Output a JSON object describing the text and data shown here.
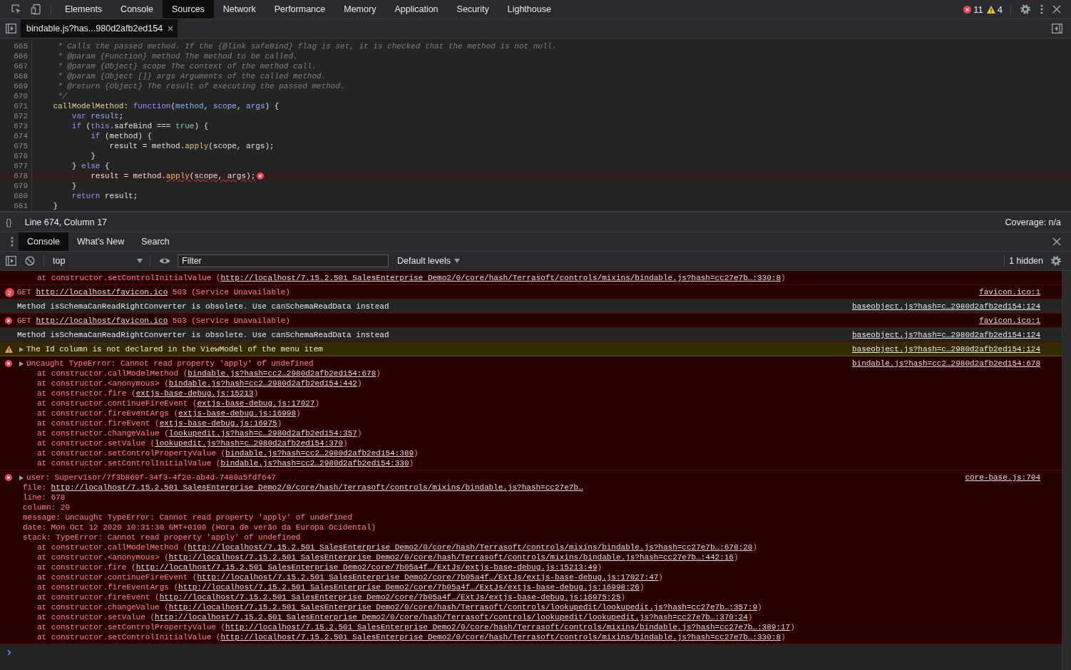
{
  "toolbar": {
    "tabs": [
      {
        "label": "Elements",
        "selected": false
      },
      {
        "label": "Console",
        "selected": false
      },
      {
        "label": "Sources",
        "selected": true
      },
      {
        "label": "Network",
        "selected": false
      },
      {
        "label": "Performance",
        "selected": false
      },
      {
        "label": "Memory",
        "selected": false
      },
      {
        "label": "Application",
        "selected": false
      },
      {
        "label": "Security",
        "selected": false
      },
      {
        "label": "Lighthouse",
        "selected": false
      }
    ],
    "error_count": "11",
    "warning_count": "4"
  },
  "editor": {
    "file_tab": "bindable.js?has...980d2afb2ed154",
    "lines": [
      {
        "number": "665",
        "error": false,
        "tokens": [
          {
            "kind": "comment",
            "text": "     * Calls the passed method. If the {@link safeBind} flag is set, it is checked that the method is not null."
          }
        ]
      },
      {
        "number": "666",
        "error": false,
        "tokens": [
          {
            "kind": "comment",
            "text": "     * @param {Function} method The method to be called."
          }
        ]
      },
      {
        "number": "667",
        "error": false,
        "tokens": [
          {
            "kind": "comment",
            "text": "     * @param {Object} scope The context of the method call."
          }
        ]
      },
      {
        "number": "668",
        "error": false,
        "tokens": [
          {
            "kind": "comment",
            "text": "     * @param {Object []} args Arguments of the called method."
          }
        ]
      },
      {
        "number": "669",
        "error": false,
        "tokens": [
          {
            "kind": "comment",
            "text": "     * @return {Object} The result of executing the passed method."
          }
        ]
      },
      {
        "number": "670",
        "error": false,
        "tokens": [
          {
            "kind": "comment",
            "text": "     */"
          }
        ]
      },
      {
        "number": "671",
        "error": false,
        "tokens": [
          {
            "kind": "def",
            "text": "    callModelMethod"
          },
          {
            "kind": "plain",
            "text": ": "
          },
          {
            "kind": "keyword",
            "text": "function"
          },
          {
            "kind": "plain",
            "text": "("
          },
          {
            "kind": "param",
            "text": "method"
          },
          {
            "kind": "plain",
            "text": ", "
          },
          {
            "kind": "param",
            "text": "scope"
          },
          {
            "kind": "plain",
            "text": ", "
          },
          {
            "kind": "param",
            "text": "args"
          },
          {
            "kind": "plain",
            "text": ") {"
          }
        ]
      },
      {
        "number": "672",
        "error": false,
        "tokens": [
          {
            "kind": "keyword",
            "text": "        var"
          },
          {
            "kind": "param",
            "text": " result"
          },
          {
            "kind": "plain",
            "text": ";"
          }
        ]
      },
      {
        "number": "673",
        "error": false,
        "tokens": [
          {
            "kind": "keyword",
            "text": "        if"
          },
          {
            "kind": "plain",
            "text": " ("
          },
          {
            "kind": "keyword",
            "text": "this"
          },
          {
            "kind": "plain",
            "text": ".safeBind === "
          },
          {
            "kind": "atom",
            "text": "true"
          },
          {
            "kind": "plain",
            "text": ") {"
          }
        ]
      },
      {
        "number": "674",
        "error": false,
        "tokens": [
          {
            "kind": "keyword",
            "text": "            if"
          },
          {
            "kind": "plain",
            "text": " (method) {"
          }
        ]
      },
      {
        "number": "675",
        "error": false,
        "tokens": [
          {
            "kind": "plain",
            "text": "                result = method."
          },
          {
            "kind": "call",
            "text": "apply"
          },
          {
            "kind": "plain",
            "text": "(scope, args);"
          }
        ]
      },
      {
        "number": "676",
        "error": false,
        "tokens": [
          {
            "kind": "plain",
            "text": "            }"
          }
        ]
      },
      {
        "number": "677",
        "error": false,
        "tokens": [
          {
            "kind": "plain",
            "text": "        } "
          },
          {
            "kind": "keyword",
            "text": "else"
          },
          {
            "kind": "plain",
            "text": " {"
          }
        ]
      },
      {
        "number": "678",
        "error": true,
        "tokens": [
          {
            "kind": "plain",
            "text": "            result = method."
          },
          {
            "kind": "call-error",
            "text": "apply"
          },
          {
            "kind": "plain-error",
            "text": "(scope, args);"
          }
        ]
      },
      {
        "number": "679",
        "error": false,
        "tokens": [
          {
            "kind": "plain",
            "text": "        }"
          }
        ]
      },
      {
        "number": "680",
        "error": false,
        "tokens": [
          {
            "kind": "keyword",
            "text": "        return"
          },
          {
            "kind": "plain",
            "text": " result;"
          }
        ]
      },
      {
        "number": "681",
        "error": false,
        "tokens": [
          {
            "kind": "plain",
            "text": "    }"
          }
        ]
      }
    ]
  },
  "status_bar": {
    "pretty_print": "{}",
    "position": "Line 674, Column 17",
    "coverage": "Coverage: n/a"
  },
  "drawer": {
    "tabs": [
      {
        "label": "Console",
        "selected": true
      },
      {
        "label": "What's New",
        "selected": false
      },
      {
        "label": "Search",
        "selected": false
      }
    ]
  },
  "console_toolbar": {
    "context": "top",
    "filter_placeholder": "Filter",
    "levels": "Default levels",
    "hidden": "1 hidden"
  },
  "messages": [
    {
      "kind": "continuation",
      "expandable": false,
      "lines": [
        {
          "kind": "frame",
          "parts": [
            "at constructor.setControlInitialValue (",
            {
              "link": "http://localhost/7.15.2.501 SalesEnterprise Demo2/0/core/hash/Terrasoft/controls/mixins/bindable.js?hash=cc27e7b…:330:8"
            },
            ")"
          ]
        }
      ]
    },
    {
      "kind": "error",
      "count": "2",
      "expandable": false,
      "source": "favicon.ico:1",
      "lines": [
        {
          "kind": "plain",
          "parts": [
            "GET ",
            {
              "link": "http://localhost/favicon.ico"
            },
            " 503 (Service Unavailable)"
          ]
        }
      ]
    },
    {
      "kind": "info",
      "expandable": false,
      "source": "baseobject.js?hash=c…2980d2afb2ed154:124",
      "lines": [
        {
          "kind": "plain",
          "parts": [
            "Method isSchemaCanReadRightConverter is obsolete. Use canSchemaReadData instead"
          ]
        }
      ]
    },
    {
      "kind": "error",
      "expandable": false,
      "source": "favicon.ico:1",
      "lines": [
        {
          "kind": "plain",
          "parts": [
            "GET ",
            {
              "link": "http://localhost/favicon.ico"
            },
            " 503 (Service Unavailable)"
          ]
        }
      ]
    },
    {
      "kind": "info",
      "expandable": false,
      "source": "baseobject.js?hash=c…2980d2afb2ed154:124",
      "lines": [
        {
          "kind": "plain",
          "parts": [
            "Method isSchemaCanReadRightConverter is obsolete. Use canSchemaReadData instead"
          ]
        }
      ]
    },
    {
      "kind": "warning",
      "expandable": true,
      "source": "baseobject.js?hash=c…2980d2afb2ed154:124",
      "lines": [
        {
          "kind": "plain",
          "parts": [
            "The Id column is not declared in the ViewModel of the menu item"
          ]
        }
      ]
    },
    {
      "kind": "error",
      "expandable": true,
      "source": "bindable.js?hash=cc2…2980d2afb2ed154:678",
      "lines": [
        {
          "kind": "plain",
          "parts": [
            "Uncaught TypeError: Cannot read property 'apply' of undefined"
          ]
        },
        {
          "kind": "frame",
          "parts": [
            "at constructor.callModelMethod (",
            {
              "link": "bindable.js?hash=cc2…2980d2afb2ed154:678"
            },
            ")"
          ]
        },
        {
          "kind": "frame",
          "parts": [
            "at constructor.<anonymous> (",
            {
              "link": "bindable.js?hash=cc2…2980d2afb2ed154:442"
            },
            ")"
          ]
        },
        {
          "kind": "frame",
          "parts": [
            "at constructor.fire (",
            {
              "link": "extjs-base-debug.js:15213"
            },
            ")"
          ]
        },
        {
          "kind": "frame",
          "parts": [
            "at constructor.continueFireEvent (",
            {
              "link": "extjs-base-debug.js:17027"
            },
            ")"
          ]
        },
        {
          "kind": "frame",
          "parts": [
            "at constructor.fireEventArgs (",
            {
              "link": "extjs-base-debug.js:16998"
            },
            ")"
          ]
        },
        {
          "kind": "frame",
          "parts": [
            "at constructor.fireEvent (",
            {
              "link": "extjs-base-debug.js:16975"
            },
            ")"
          ]
        },
        {
          "kind": "frame",
          "parts": [
            "at constructor.changeValue (",
            {
              "link": "lookupedit.js?hash=c…2980d2afb2ed154:357"
            },
            ")"
          ]
        },
        {
          "kind": "frame",
          "parts": [
            "at constructor.setValue (",
            {
              "link": "lookupedit.js?hash=c…2980d2afb2ed154:370"
            },
            ")"
          ]
        },
        {
          "kind": "frame",
          "parts": [
            "at constructor.setControlPropertyValue (",
            {
              "link": "bindable.js?hash=cc2…2980d2afb2ed154:389"
            },
            ")"
          ]
        },
        {
          "kind": "frame",
          "parts": [
            "at constructor.setControlInitialValue (",
            {
              "link": "bindable.js?hash=cc2…2980d2afb2ed154:330"
            },
            ")"
          ]
        }
      ]
    },
    {
      "kind": "error",
      "expandable": true,
      "source": "core-base.js:704",
      "lines": [
        {
          "kind": "plain",
          "parts": [
            "user: Supervisor/7f3b869f-34f3-4f20-ab4d-7480a5fdf647"
          ]
        },
        {
          "kind": "field",
          "parts": [
            "file: ",
            {
              "link": "http://localhost/7.15.2.501 SalesEnterprise Demo2/0/core/hash/Terrasoft/controls/mixins/bindable.js?hash=cc27e7b…"
            }
          ]
        },
        {
          "kind": "field",
          "parts": [
            "line: 678"
          ]
        },
        {
          "kind": "field",
          "parts": [
            "column: 20"
          ]
        },
        {
          "kind": "field",
          "parts": [
            "message: Uncaught TypeError: Cannot read property 'apply' of undefined"
          ]
        },
        {
          "kind": "field",
          "parts": [
            "date: Mon Oct 12 2020 10:31:30 GMT+0100 (Hora de verão da Europa Ocidental)"
          ]
        },
        {
          "kind": "field",
          "parts": [
            "stack: TypeError: Cannot read property 'apply' of undefined"
          ]
        },
        {
          "kind": "frame",
          "parts": [
            "at constructor.callModelMethod (",
            {
              "link": "http://localhost/7.15.2.501 SalesEnterprise Demo2/0/core/hash/Terrasoft/controls/mixins/bindable.js?hash=cc27e7b…:678:20"
            },
            ")"
          ]
        },
        {
          "kind": "frame",
          "parts": [
            "at constructor.<anonymous> (",
            {
              "link": "http://localhost/7.15.2.501 SalesEnterprise Demo2/0/core/hash/Terrasoft/controls/mixins/bindable.js?hash=cc27e7b…:442:16"
            },
            ")"
          ]
        },
        {
          "kind": "frame",
          "parts": [
            "at constructor.fire (",
            {
              "link": "http://localhost/7.15.2.501 SalesEnterprise Demo2/core/7b05a4f…/ExtJs/extjs-base-debug.js:15213:49"
            },
            ")"
          ]
        },
        {
          "kind": "frame",
          "parts": [
            "at constructor.continueFireEvent (",
            {
              "link": "http://localhost/7.15.2.501 SalesEnterprise Demo2/core/7b05a4f…/ExtJs/extjs-base-debug.js:17027:47"
            },
            ")"
          ]
        },
        {
          "kind": "frame",
          "parts": [
            "at constructor.fireEventArgs (",
            {
              "link": "http://localhost/7.15.2.501 SalesEnterprise Demo2/core/7b05a4f…/ExtJs/extjs-base-debug.js:16998:26"
            },
            ")"
          ]
        },
        {
          "kind": "frame",
          "parts": [
            "at constructor.fireEvent (",
            {
              "link": "http://localhost/7.15.2.501 SalesEnterprise Demo2/core/7b05a4f…/ExtJs/extjs-base-debug.js:16975:25"
            },
            ")"
          ]
        },
        {
          "kind": "frame",
          "parts": [
            "at constructor.changeValue (",
            {
              "link": "http://localhost/7.15.2.501 SalesEnterprise Demo2/0/core/hash/Terrasoft/controls/lookupedit/lookupedit.js?hash=cc27e7b…:357:9"
            },
            ")"
          ]
        },
        {
          "kind": "frame",
          "parts": [
            "at constructor.setValue (",
            {
              "link": "http://localhost/7.15.2.501 SalesEnterprise Demo2/0/core/hash/Terrasoft/controls/lookupedit/lookupedit.js?hash=cc27e7b…:370:24"
            },
            ")"
          ]
        },
        {
          "kind": "frame",
          "parts": [
            "at constructor.setControlPropertyValue (",
            {
              "link": "http://localhost/7.15.2.501 SalesEnterprise Demo2/0/core/hash/Terrasoft/controls/mixins/bindable.js?hash=cc27e7b…:389:17"
            },
            ")"
          ]
        },
        {
          "kind": "frame",
          "parts": [
            "at constructor.setControlInitialValue (",
            {
              "link": "http://localhost/7.15.2.501 SalesEnterprise Demo2/0/core/hash/Terrasoft/controls/mixins/bindable.js?hash=cc27e7b…:330:8"
            },
            ")"
          ]
        }
      ]
    }
  ]
}
